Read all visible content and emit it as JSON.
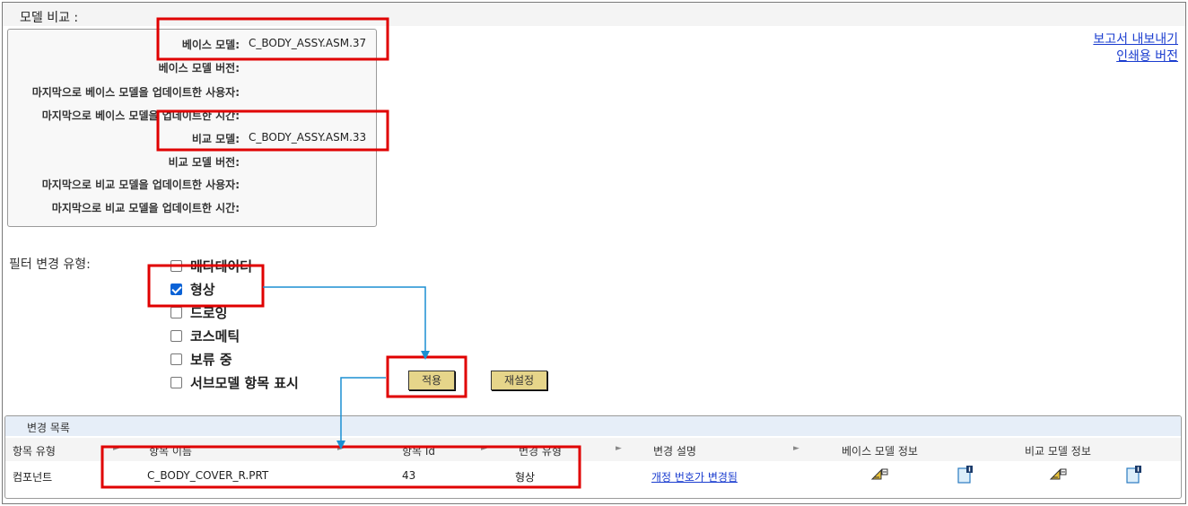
{
  "section_title": "모델 비교 :",
  "model_info": [
    {
      "label": "베이스 모델:",
      "value": "C_BODY_ASSY.ASM.37"
    },
    {
      "label": "베이스 모델 버전:",
      "value": ""
    },
    {
      "label": "마지막으로 베이스 모델을 업데이트한 사용자:",
      "value": ""
    },
    {
      "label": "마지막으로 베이스 모델을 업데이트한 시간:",
      "value": ""
    },
    {
      "label": "비교 모델:",
      "value": "C_BODY_ASSY.ASM.33"
    },
    {
      "label": "비교 모델 버전:",
      "value": ""
    },
    {
      "label": "마지막으로 비교 모델을 업데이트한 사용자:",
      "value": ""
    },
    {
      "label": "마지막으로 비교 모델을 업데이트한 시간:",
      "value": ""
    }
  ],
  "links": {
    "export_report": "보고서 내보내기",
    "print_version": "인쇄용 버전"
  },
  "filter": {
    "label": "필터 변경 유형:",
    "options": [
      {
        "label": "메타데이터",
        "checked": false
      },
      {
        "label": "형상",
        "checked": true
      },
      {
        "label": "드로잉",
        "checked": false
      },
      {
        "label": "코스메틱",
        "checked": false
      },
      {
        "label": "보류 중",
        "checked": false
      },
      {
        "label": "서브모델 항목 표시",
        "checked": false
      }
    ],
    "apply_label": "적용",
    "reset_label": "재설정"
  },
  "change_list": {
    "title": "변경 목록",
    "columns": [
      "항목 유형",
      "항목 이름",
      "항목 Id",
      "변경 유형",
      "변경 설명",
      "베이스 모델 정보",
      "비교 모델 정보"
    ],
    "rows": [
      {
        "item_type": "컴포넌트",
        "item_name": "C_BODY_COVER_R.PRT",
        "item_id": "43",
        "change_type": "형상",
        "change_desc": "개정 번호가 변경됨",
        "base_icons": [
          "measure-icon",
          "note-icon"
        ],
        "compare_icons": [
          "measure-icon",
          "note-icon"
        ]
      }
    ]
  },
  "colors": {
    "highlight": "#e00000",
    "arrow": "#1b8fd2",
    "button": "#e6d58a",
    "link": "#1a3ccf"
  }
}
